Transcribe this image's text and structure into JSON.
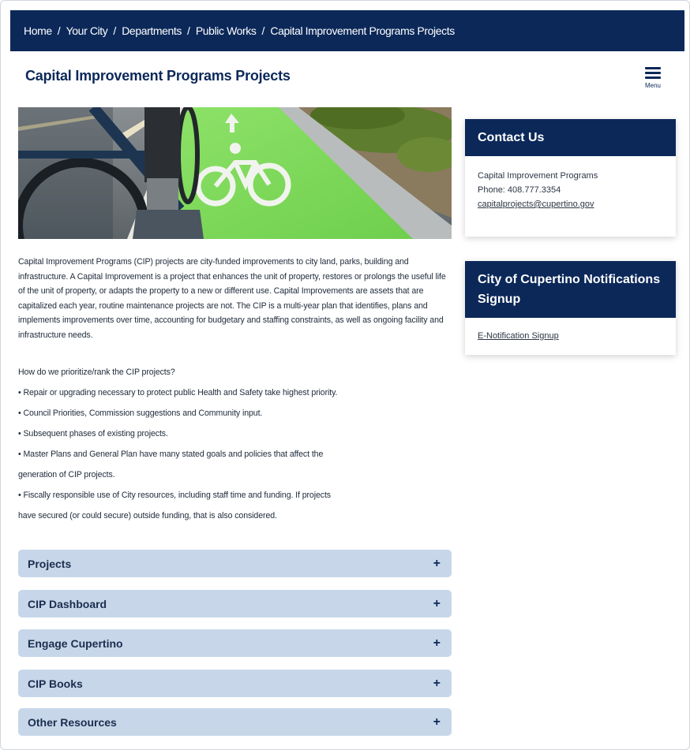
{
  "breadcrumb": {
    "items": [
      "Home",
      "Your City",
      "Departments",
      "Public Works",
      "Capital Improvement Programs Projects"
    ],
    "separator": "/"
  },
  "page": {
    "title": "Capital Improvement Programs Projects",
    "menu_label": "Menu"
  },
  "content": {
    "intro": "Capital Improvement Programs (CIP) projects are city-funded improvements to city land, parks, building and infrastructure. A Capital Improvement is a project that enhances the unit of property, restores or prolongs the useful life of the unit of property, or adapts the property to a new or different use. Capital Improvements are assets that are capitalized each year, routine maintenance projects are not. The CIP is a multi-year plan that identifies, plans and implements improvements over time, accounting for budgetary and staffing constraints, as well as ongoing facility and infrastructure needs.",
    "priority_lines": [
      "How do we prioritize/rank the CIP projects?",
      "• Repair or upgrading necessary to protect public Health and Safety take highest priority.",
      "• Council Priorities, Commission suggestions and Community input.",
      "• Subsequent phases of existing projects.",
      "• Master Plans and General Plan have many stated goals and policies that affect the",
      "generation of CIP projects.",
      "• Fiscally responsible use of City resources, including staff time and funding. If projects",
      "have secured (or could secure) outside funding, that is also considered."
    ]
  },
  "accordions": [
    {
      "label": "Projects",
      "icon": "plus-icon",
      "symbol": "+"
    },
    {
      "label": "CIP Dashboard",
      "icon": "plus-icon",
      "symbol": "+"
    },
    {
      "label": "Engage Cupertino",
      "icon": "plus-icon",
      "symbol": "+"
    },
    {
      "label": "CIP Books",
      "icon": "plus-icon",
      "symbol": "+"
    },
    {
      "label": "Other Resources",
      "icon": "plus-icon",
      "symbol": "+"
    }
  ],
  "sidebar": {
    "contact": {
      "heading": "Contact Us",
      "name": "Capital Improvement Programs",
      "phone": "Phone: 408.777.3354",
      "email": "capitalprojects@cupertino.gov"
    },
    "notifications": {
      "heading": "City of Cupertino Notifications Signup",
      "link": "E-Notification Signup"
    }
  },
  "colors": {
    "navy": "#0b2859",
    "accordion_bg": "#c7d7e9",
    "bike_lane_green": "#7ed957"
  }
}
